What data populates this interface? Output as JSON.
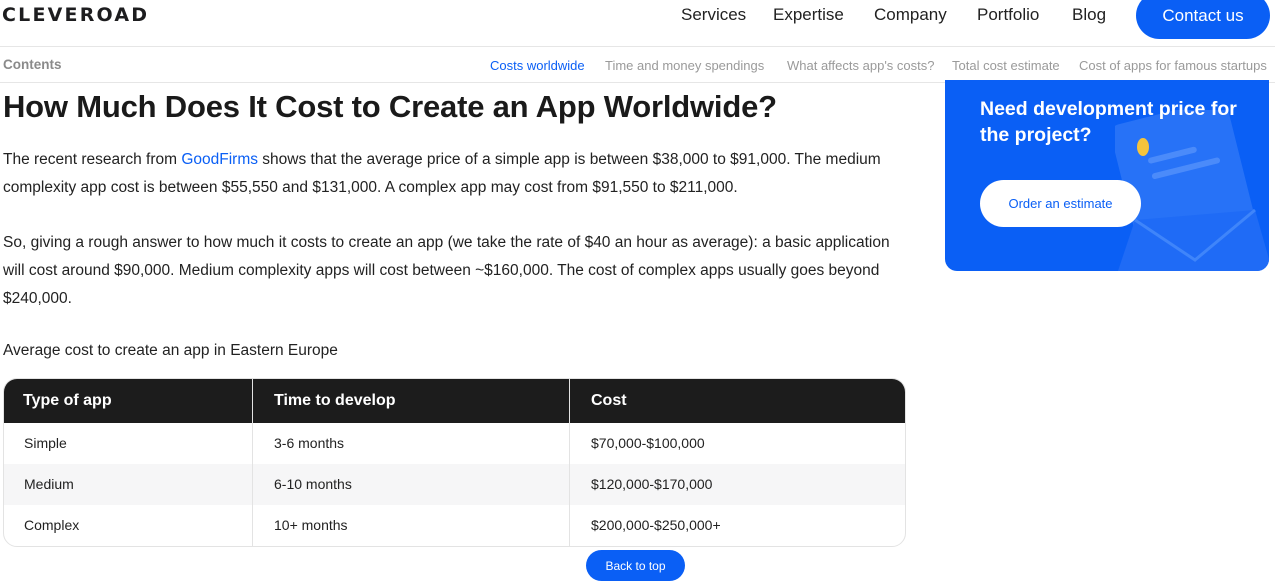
{
  "header": {
    "logo": "CLEVEROAD",
    "nav": [
      "Services",
      "Expertise",
      "Company",
      "Portfolio",
      "Blog"
    ],
    "contact_label": "Contact us"
  },
  "contents": {
    "label": "Contents",
    "items": [
      "Costs worldwide",
      "Time and money spendings",
      "What affects app's costs?",
      "Total cost estimate",
      "Cost of apps for famous startups"
    ],
    "active_index": 0
  },
  "article": {
    "title": "How Much Does It Cost to Create an App Worldwide?",
    "p1_before": "The recent research from ",
    "p1_link": "GoodFirms",
    "p1_after": " shows that the average price of a simple app is between $38,000 to $91,000. The medium complexity app cost is between $55,550 and $131,000. A complex app may cost from $91,550 to $211,000.",
    "p2": "So, giving a rough answer to how much it costs to create an app (we take the rate of $40 an hour as average): a basic application will cost around $90,000. Medium complexity apps will cost between ~$160,000. The cost of complex apps usually goes beyond $240,000.",
    "table_caption": "Average cost to create an app in Eastern Europe",
    "table": {
      "headers": [
        "Type of app",
        "Time to develop",
        "Cost"
      ],
      "rows": [
        [
          "Simple",
          "3-6 months",
          "$70,000-$100,000"
        ],
        [
          "Medium",
          "6-10 months",
          "$120,000-$170,000"
        ],
        [
          "Complex",
          "10+ months",
          "$200,000-$250,000+"
        ]
      ]
    }
  },
  "sidebar": {
    "title": "Need development price for the project?",
    "button_label": "Order an estimate"
  },
  "back_to_top": "Back to top",
  "colors": {
    "accent": "#0a5ff5",
    "table_header": "#1c1c1c",
    "toc_inactive": "#9a9a9a"
  }
}
